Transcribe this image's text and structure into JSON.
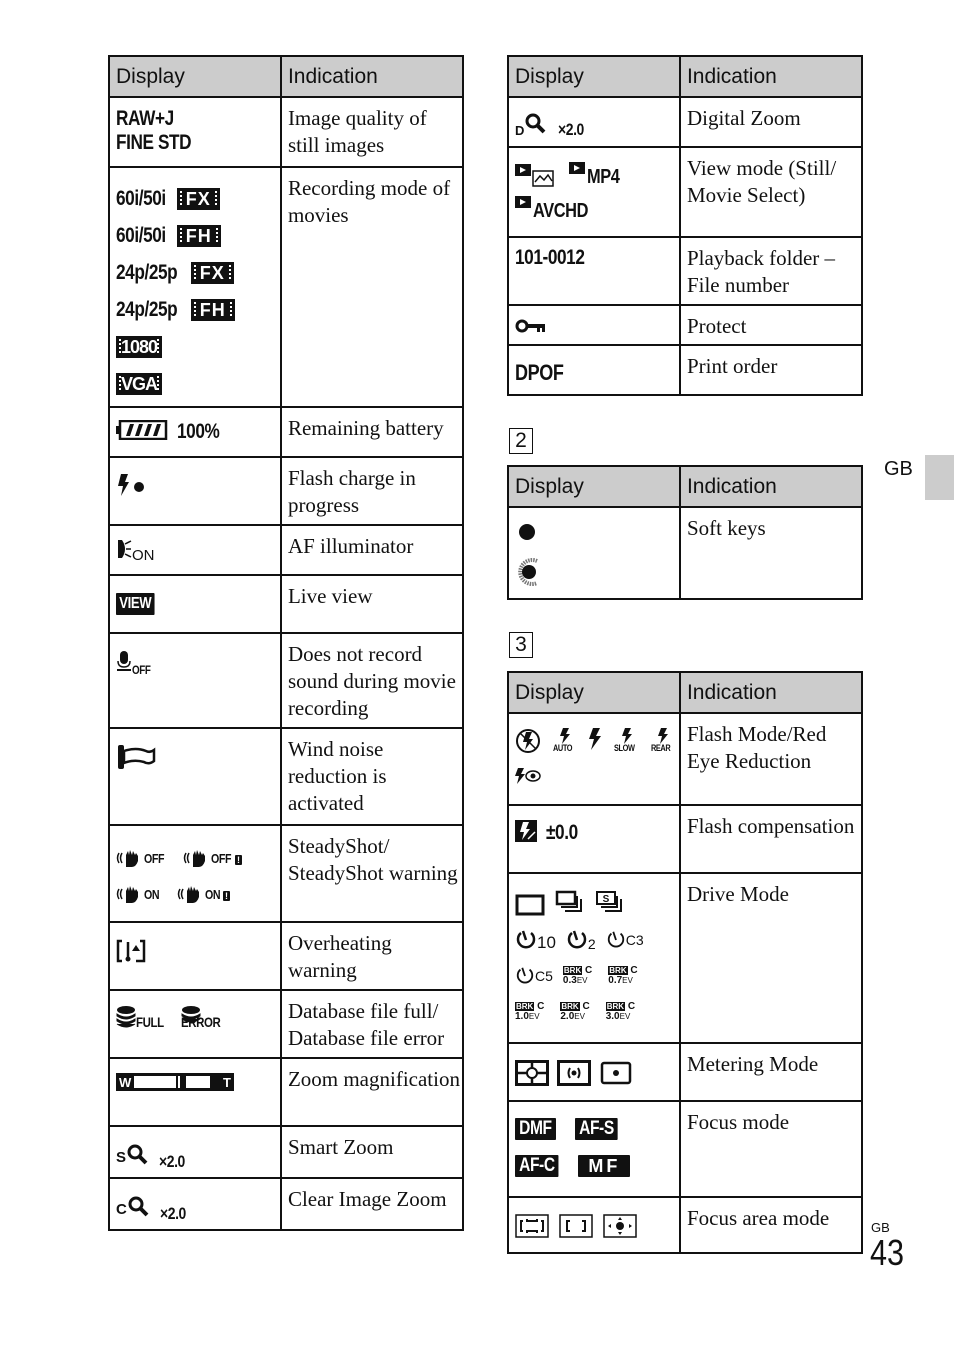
{
  "headers": {
    "display": "Display",
    "indication": "Indication"
  },
  "left_table": {
    "rows": [
      {
        "display": [
          "RAW+J",
          "FINE STD"
        ],
        "indication": "Image quality of still images"
      },
      {
        "display_lines": [
          {
            "text": "60i/50i",
            "badge": "FX"
          },
          {
            "text": "60i/50i",
            "badge": "FH"
          },
          {
            "text": "24p/25p",
            "badge": "FX"
          },
          {
            "text": "24p/25p",
            "badge": "FH"
          },
          {
            "text": "",
            "badge": "1080"
          },
          {
            "text": "",
            "badge": "VGA"
          }
        ],
        "indication": "Recording mode of movies"
      },
      {
        "display": "100%",
        "icon": "battery-icon",
        "indication": "Remaining battery"
      },
      {
        "icon": "flash-charging-icon",
        "indication": "Flash charge in progress"
      },
      {
        "icon": "af-illuminator-icon",
        "sub": "ON",
        "indication": "AF illuminator"
      },
      {
        "badge": "VIEW",
        "indication": "Live view"
      },
      {
        "icon": "microphone-off-icon",
        "sub": "OFF",
        "indication": "Does not record sound during movie recording"
      },
      {
        "icon": "wind-noise-icon",
        "indication": "Wind noise reduction is activated"
      },
      {
        "icons": [
          "steadyshot-off-icon",
          "steadyshot-off-warning-icon",
          "steadyshot-on-icon",
          "steadyshot-on-warning-icon"
        ],
        "labels": [
          "OFF",
          "OFF",
          "ON",
          "ON"
        ],
        "indication": "SteadyShot/ SteadyShot warning"
      },
      {
        "icon": "overheating-icon",
        "indication": "Overheating warning"
      },
      {
        "icons": [
          "database-full-icon",
          "database-error-icon"
        ],
        "labels": [
          "FULL",
          "ERROR"
        ],
        "indication": "Database file full/ Database file error"
      },
      {
        "zoom_bar": {
          "w": "W",
          "t": "T",
          "level": 0.65
        },
        "indication": "Zoom magnification"
      },
      {
        "prefix": "S",
        "value": "×2.0",
        "icon": "magnifier-icon",
        "indication": "Smart Zoom"
      },
      {
        "prefix": "C",
        "value": "×2.0",
        "icon": "magnifier-icon",
        "indication": "Clear Image Zoom"
      }
    ]
  },
  "right_table_1": {
    "rows": [
      {
        "prefix": "D",
        "value": "×2.0",
        "icon": "magnifier-icon",
        "indication": "Digital Zoom"
      },
      {
        "labels": [
          "MP4",
          "AVCHD"
        ],
        "indication": "View mode (Still/ Movie Select)"
      },
      {
        "display": "101-0012",
        "indication": "Playback folder – File number"
      },
      {
        "icon": "protect-key-icon",
        "indication": "Protect"
      },
      {
        "display": "DPOF",
        "indication": "Print order"
      }
    ]
  },
  "section2": {
    "number": "2",
    "rows": [
      {
        "icons": [
          "soft-key-dot-icon",
          "soft-key-dial-icon"
        ],
        "indication": "Soft keys"
      }
    ]
  },
  "section3": {
    "number": "3",
    "rows": [
      {
        "labels": [
          "AUTO",
          "SLOW",
          "REAR"
        ],
        "indication": "Flash Mode/Red Eye Reduction"
      },
      {
        "value": "±0.0",
        "indication": "Flash compensation"
      },
      {
        "timer_labels": [
          "10",
          "2",
          "C3",
          "C5"
        ],
        "brk_labels": [
          "0.3",
          "0.7",
          "1.0",
          "2.0",
          "3.0"
        ],
        "brk_tag": "BRK",
        "brk_c": "C",
        "ev": "EV",
        "indication": "Drive Mode"
      },
      {
        "indication": "Metering Mode"
      },
      {
        "badges": [
          "DMF",
          "AF-S",
          "AF-C",
          "MF"
        ],
        "indication": "Focus mode"
      },
      {
        "indication": "Focus area mode"
      }
    ]
  },
  "side_tab": "GB",
  "page": {
    "lang": "GB",
    "number": "43"
  }
}
